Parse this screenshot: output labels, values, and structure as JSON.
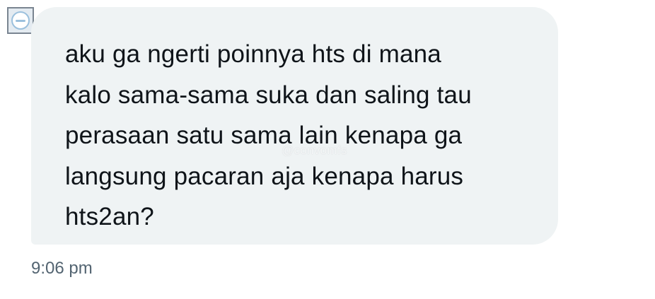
{
  "message": {
    "text": "aku ga ngerti poinnya hts di mana\nkalo sama-sama suka dan saling tau\nperasaan satu sama lain kenapa ga\nlangsung pacaran aja kenapa harus\nhts2an?",
    "watermark": "@convomfs",
    "timestamp": "9:06 pm"
  },
  "avatar": {
    "icon": "default-avatar-icon"
  },
  "colors": {
    "bubble_bg": "#eff3f4",
    "text": "#0f1419",
    "timestamp": "#536471"
  }
}
